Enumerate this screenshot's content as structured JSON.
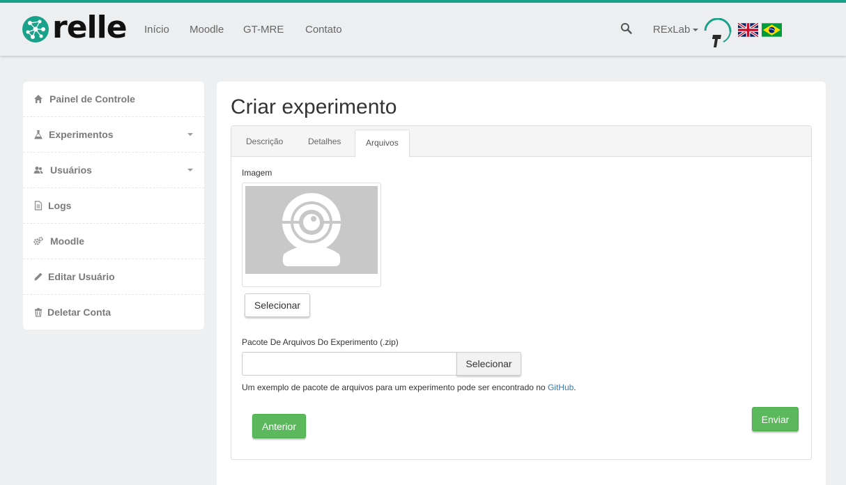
{
  "header": {
    "brand": "relle",
    "nav": [
      "Início",
      "Moodle",
      "GT-MRE",
      "Contato"
    ],
    "user_label": "RExLab",
    "accent_color": "#1aa18a"
  },
  "sidebar": {
    "items": [
      {
        "label": "Painel de Controle",
        "icon": "home-icon"
      },
      {
        "label": "Experimentos",
        "icon": "flask-icon",
        "has_submenu": true
      },
      {
        "label": "Usuários",
        "icon": "users-icon",
        "has_submenu": true
      },
      {
        "label": "Logs",
        "icon": "file-icon"
      },
      {
        "label": "Moodle",
        "icon": "cogs-icon"
      },
      {
        "label": "Editar Usuário",
        "icon": "pencil-icon"
      },
      {
        "label": "Deletar Conta",
        "icon": "trash-icon"
      }
    ]
  },
  "main": {
    "title": "Criar experimento",
    "tabs": [
      {
        "label": "Descrição",
        "active": false
      },
      {
        "label": "Detalhes",
        "active": false
      },
      {
        "label": "Arquivos",
        "active": true
      }
    ],
    "image_label": "Imagem",
    "image_button": "Selecionar",
    "package_label": "Pacote De Arquivos Do Experimento (.zip)",
    "package_value": "",
    "package_button": "Selecionar",
    "hint_text": "Um exemplo de pacote de arquivos para um experimento pode ser encontrado no ",
    "hint_link": "GitHub",
    "hint_end": ".",
    "prev_button": "Anterior",
    "submit_button": "Enviar",
    "button_color": "#5cb85c"
  }
}
